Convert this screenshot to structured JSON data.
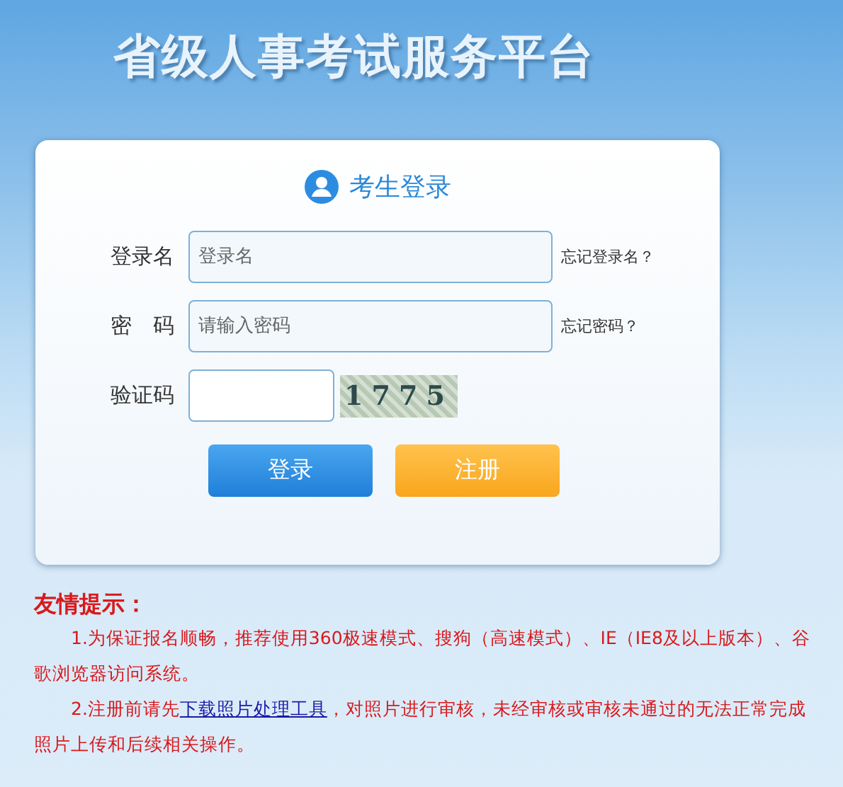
{
  "title": "省级人事考试服务平台",
  "login": {
    "heading": "考生登录",
    "fields": [
      {
        "label": "登录名",
        "placeholder": "登录名",
        "link": "忘记登录名？"
      },
      {
        "label": "密　码",
        "placeholder": "请输入密码",
        "link": "忘记密码？"
      }
    ],
    "captcha": {
      "label": "验证码",
      "code": "1775"
    },
    "buttons": [
      {
        "label": "登录",
        "kind": "primary"
      },
      {
        "label": "注册",
        "kind": "secondary"
      }
    ]
  },
  "tips": {
    "heading": "友情提示：",
    "items": [
      {
        "text": "1.为保证报名顺畅，推荐使用360极速模式、搜狗（高速模式）、IE（IE8及以上版本）、谷歌浏览器访问系统。"
      },
      {
        "before": "2.注册前请先",
        "link": "下载照片处理工具",
        "after": "，对照片进行审核，未经审核或审核未通过的无法正常完成照片上传和后续相关操作。"
      }
    ]
  }
}
